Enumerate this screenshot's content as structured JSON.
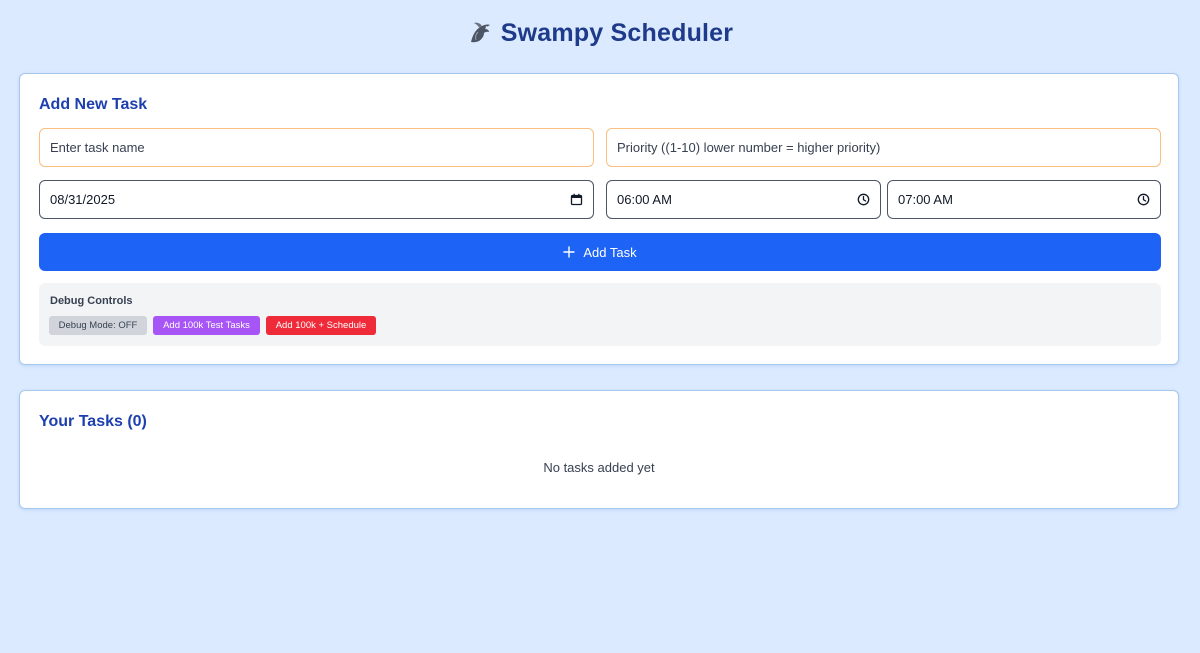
{
  "header": {
    "title": "Swampy Scheduler",
    "logo_icon": "dragon-icon"
  },
  "add_task": {
    "heading": "Add New Task",
    "name_placeholder": "Enter task name",
    "priority_placeholder": "Priority ((1-10) lower number = higher priority)",
    "date_value": "08/31/2025",
    "start_time_value": "06:00 AM",
    "end_time_value": "07:00 AM",
    "add_button_label": "Add Task",
    "date_icon": "calendar-icon",
    "time_icon": "clock-icon",
    "button_icon": "plus-icon"
  },
  "debug": {
    "heading": "Debug Controls",
    "toggle_label": "Debug Mode: OFF",
    "add_100k_label": "Add 100k Test Tasks",
    "add_100k_schedule_label": "Add 100k + Schedule"
  },
  "tasks": {
    "heading": "Your Tasks (0)",
    "empty_message": "No tasks added yet"
  },
  "colors": {
    "background": "#dbeafe",
    "primary": "#1d63f5",
    "heading": "#1e40af",
    "debug_purple": "#a855f7",
    "debug_red": "#ef2b3a"
  }
}
